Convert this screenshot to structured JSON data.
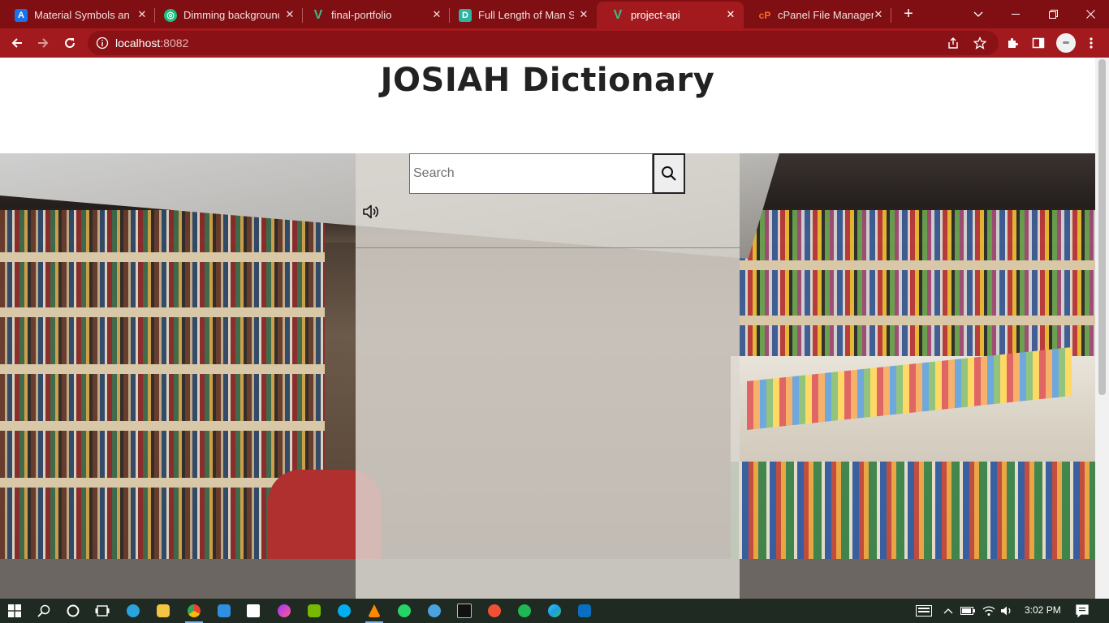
{
  "browser": {
    "tabs": [
      {
        "title": "Material Symbols and",
        "favicon": "google-fonts-icon",
        "color": "#ea4335",
        "active": false
      },
      {
        "title": "Dimming background",
        "favicon": "chatgpt-icon",
        "color": "#10a37f",
        "active": false
      },
      {
        "title": "final-portfolio",
        "favicon": "vue-icon",
        "color": "#41b883",
        "active": false
      },
      {
        "title": "Full Length of Man Sit",
        "favicon": "doc-icon",
        "color": "#2bb5a0",
        "active": false
      },
      {
        "title": "project-api",
        "favicon": "vue-icon",
        "color": "#41b883",
        "active": true
      },
      {
        "title": "cPanel File Manager v",
        "favicon": "cpanel-icon",
        "color": "#ff6c2c",
        "active": false
      }
    ],
    "address_bar": {
      "host": "localhost",
      "port": ":8082"
    },
    "theme_color": "#a31a1e"
  },
  "page": {
    "title": "JOSIAH Dictionary",
    "search": {
      "placeholder": "Search",
      "value": ""
    },
    "search_button_icon": "search-icon",
    "audio_button_icon": "speaker-icon"
  },
  "taskbar": {
    "apps": [
      "windows-start-icon",
      "search-icon",
      "cortana-icon",
      "task-view-icon",
      "telegram-icon",
      "file-explorer-icon",
      "chrome-icon",
      "vscode-icon",
      "store-icon",
      "messenger-icon",
      "nvidia-icon",
      "skype-icon",
      "vlc-icon",
      "whatsapp-icon",
      "network-icon",
      "terminal-icon",
      "git-icon",
      "spotify-icon",
      "edge-icon",
      "remote-desktop-icon"
    ],
    "time": "3:02 PM"
  }
}
